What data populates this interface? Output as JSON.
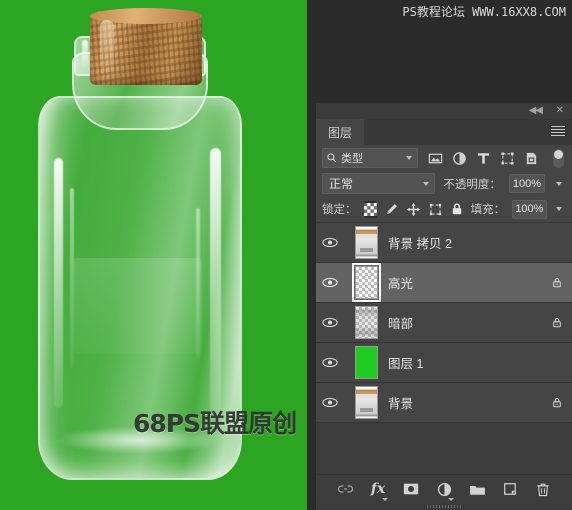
{
  "watermarks": {
    "top": "PS教程论坛 WWW.16XX8.COM",
    "canvas": "68PS联盟原创"
  },
  "canvas": {
    "background_color": "#2ba522",
    "subject": "glass-jar-with-cork"
  },
  "panel": {
    "tab_label": "图层",
    "collapse_icon": "◀◀",
    "close_icon": "✕",
    "menu_icon": "panel-menu-icon",
    "filter": {
      "search_icon": "search-icon",
      "type_label": "类型",
      "icons": [
        "pixel-filter-icon",
        "adjustment-filter-icon",
        "text-filter-icon",
        "shape-filter-icon",
        "smartobject-filter-icon"
      ],
      "toggle_state": "on"
    },
    "blend": {
      "mode": "正常",
      "opacity_label": "不透明度：",
      "opacity_value": "100%"
    },
    "lock": {
      "label": "锁定：",
      "buttons": [
        "lock-transparency-icon",
        "lock-image-icon",
        "lock-position-icon",
        "lock-artboard-icon",
        "lock-all-icon"
      ],
      "active_index": 0,
      "fill_label": "填充：",
      "fill_value": "100%"
    },
    "layers": [
      {
        "name": "背景 拷贝 2",
        "visible": true,
        "locked": false,
        "selected": false,
        "thumb": "jar"
      },
      {
        "name": "高光",
        "visible": true,
        "locked": true,
        "selected": true,
        "thumb": "transparent"
      },
      {
        "name": "暗部",
        "visible": true,
        "locked": true,
        "selected": false,
        "thumb": "dark"
      },
      {
        "name": "图层 1",
        "visible": true,
        "locked": false,
        "selected": false,
        "thumb": "green",
        "thumb_color": "#1fcc1f"
      },
      {
        "name": "背景",
        "visible": true,
        "locked": true,
        "selected": false,
        "thumb": "jar"
      }
    ],
    "bottom_toolbar": [
      "link-layers-icon",
      "layer-style-fx-icon",
      "add-layer-mask-icon",
      "new-adjustment-layer-icon",
      "new-group-icon",
      "new-layer-icon",
      "delete-layer-icon"
    ]
  }
}
